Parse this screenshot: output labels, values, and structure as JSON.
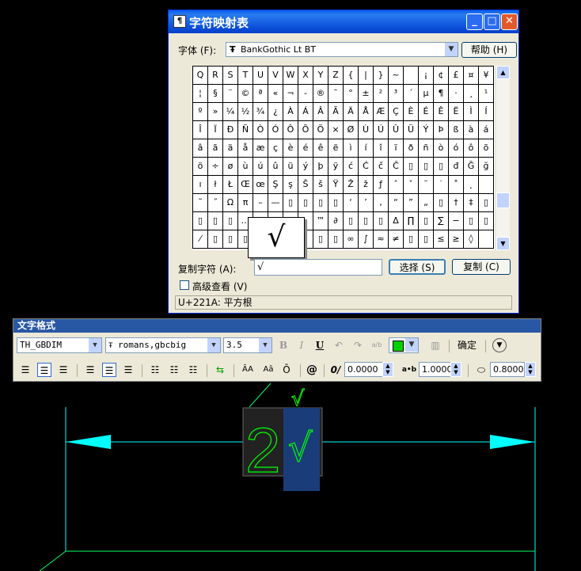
{
  "charmap": {
    "title": "字符映射表",
    "font_label": "字体 (F):",
    "font_value": "BankGothic Lt BT",
    "help_label": "帮助 (H)",
    "grid_rows": [
      [
        "Q",
        "R",
        "S",
        "T",
        "U",
        "V",
        "W",
        "X",
        "Y",
        "Z",
        "{",
        "|",
        "}",
        "~",
        "",
        "¡",
        "¢",
        "£",
        "¤",
        "¥"
      ],
      [
        "¦",
        "§",
        "¨",
        "©",
        "ª",
        "«",
        "¬",
        "-",
        "®",
        "¯",
        "°",
        "±",
        "²",
        "³",
        "´",
        "µ",
        "¶",
        "·",
        "¸",
        "¹"
      ],
      [
        "º",
        "»",
        "¼",
        "½",
        "¾",
        "¿",
        "À",
        "Á",
        "Â",
        "Ã",
        "Ä",
        "Å",
        "Æ",
        "Ç",
        "È",
        "É",
        "Ê",
        "Ë",
        "Ì",
        "Í"
      ],
      [
        "Î",
        "Ï",
        "Ð",
        "Ñ",
        "Ò",
        "Ó",
        "Ô",
        "Õ",
        "Ö",
        "×",
        "Ø",
        "Ù",
        "Ú",
        "Û",
        "Ü",
        "Ý",
        "Þ",
        "ß",
        "à",
        "á"
      ],
      [
        "â",
        "ã",
        "ä",
        "å",
        "æ",
        "ç",
        "è",
        "é",
        "ê",
        "ë",
        "ì",
        "í",
        "î",
        "ï",
        "ð",
        "ñ",
        "ò",
        "ó",
        "ô",
        "õ"
      ],
      [
        "ö",
        "÷",
        "ø",
        "ù",
        "ú",
        "û",
        "ü",
        "ý",
        "þ",
        "ÿ",
        "ć",
        "Ć",
        "č",
        "Č",
        "▯",
        "▯",
        "▯",
        "đ",
        "Ğ",
        "ğ"
      ],
      [
        "ı",
        "ł",
        "Ł",
        "Œ",
        "œ",
        "Ş",
        "ş",
        "Š",
        "š",
        "Ÿ",
        "Ž",
        "ž",
        "ƒ",
        "ˆ",
        "ˇ",
        "˘",
        "˙",
        "˚",
        "˛",
        ""
      ],
      [
        "˜",
        "˝",
        "Ω",
        "π",
        "–",
        "—",
        "▯",
        "▯",
        "▯",
        "▯",
        "‘",
        "’",
        "‚",
        "“",
        "”",
        "„",
        "▯",
        "†",
        "‡",
        "▯"
      ],
      [
        "▯",
        "▯",
        "▯",
        "…",
        "",
        "",
        "",
        "",
        "™",
        "∂",
        "▯",
        "▯",
        "▯",
        "Δ",
        "∏",
        "▯",
        "∑",
        "−",
        "▯",
        "▯"
      ],
      [
        "⁄",
        "▯",
        "▯",
        "▯",
        "",
        "",
        "",
        "",
        "▯",
        "▯",
        "∞",
        "∫",
        "≈",
        "≠",
        "▯",
        "▯",
        "≤",
        "≥",
        "◊",
        ""
      ]
    ],
    "zoom_char": "√",
    "copy_label": "复制字符 (A):",
    "copy_value": "√",
    "select_label": "选择 (S)",
    "copy_button_label": "复制 (C)",
    "advanced_label": "高级查看 (V)",
    "status": "U+221A: 平方根"
  },
  "textfmt": {
    "title": "文字格式",
    "style_value": "TH_GBDIM",
    "font_value": "romans,gbcbig",
    "height_value": "3.5",
    "bold": "B",
    "italic": "I",
    "underline": "U",
    "stack": "a/b",
    "ok_label": "确定",
    "case_upper": "ĀA",
    "case_lower": "Aā",
    "at": "@",
    "oblique_icon": "0/",
    "oblique_value": "0.0000",
    "tracking_icon": "a•b",
    "tracking_value": "1.0000",
    "width_value": "0.8000",
    "accent_color": "#00d000"
  },
  "cad": {
    "digit": "2",
    "symbol": "√",
    "line_color": "#00ff00",
    "dim_color": "#00ffff"
  }
}
